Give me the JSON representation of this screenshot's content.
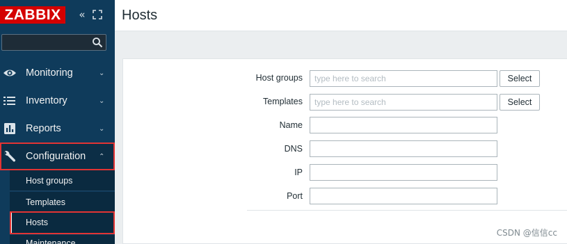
{
  "sidebar": {
    "logo": "ZABBIX",
    "collapse_icon": "«",
    "search": {
      "value": "",
      "placeholder": ""
    },
    "menu": [
      {
        "label": "Monitoring",
        "icon": "eye-icon",
        "arrow": "⌄"
      },
      {
        "label": "Inventory",
        "icon": "list-icon",
        "arrow": "⌄"
      },
      {
        "label": "Reports",
        "icon": "bar-chart-icon",
        "arrow": "⌄"
      },
      {
        "label": "Configuration",
        "icon": "wrench-icon",
        "arrow": "⌃"
      }
    ],
    "submenu": [
      {
        "label": "Host groups"
      },
      {
        "label": "Templates"
      },
      {
        "label": "Hosts"
      },
      {
        "label": "Maintenance"
      }
    ]
  },
  "header": {
    "title": "Hosts"
  },
  "filter": {
    "host_groups": {
      "label": "Host groups",
      "placeholder": "type here to search",
      "button": "Select"
    },
    "templates": {
      "label": "Templates",
      "placeholder": "type here to search",
      "button": "Select"
    },
    "name": {
      "label": "Name",
      "value": ""
    },
    "dns": {
      "label": "DNS",
      "value": ""
    },
    "ip": {
      "label": "IP",
      "value": ""
    },
    "port": {
      "label": "Port",
      "value": ""
    }
  },
  "watermark": "CSDN @信信cc",
  "colors": {
    "sidebar": "#0f3b5b",
    "logo": "#d40000",
    "highlight": "#e33434"
  }
}
